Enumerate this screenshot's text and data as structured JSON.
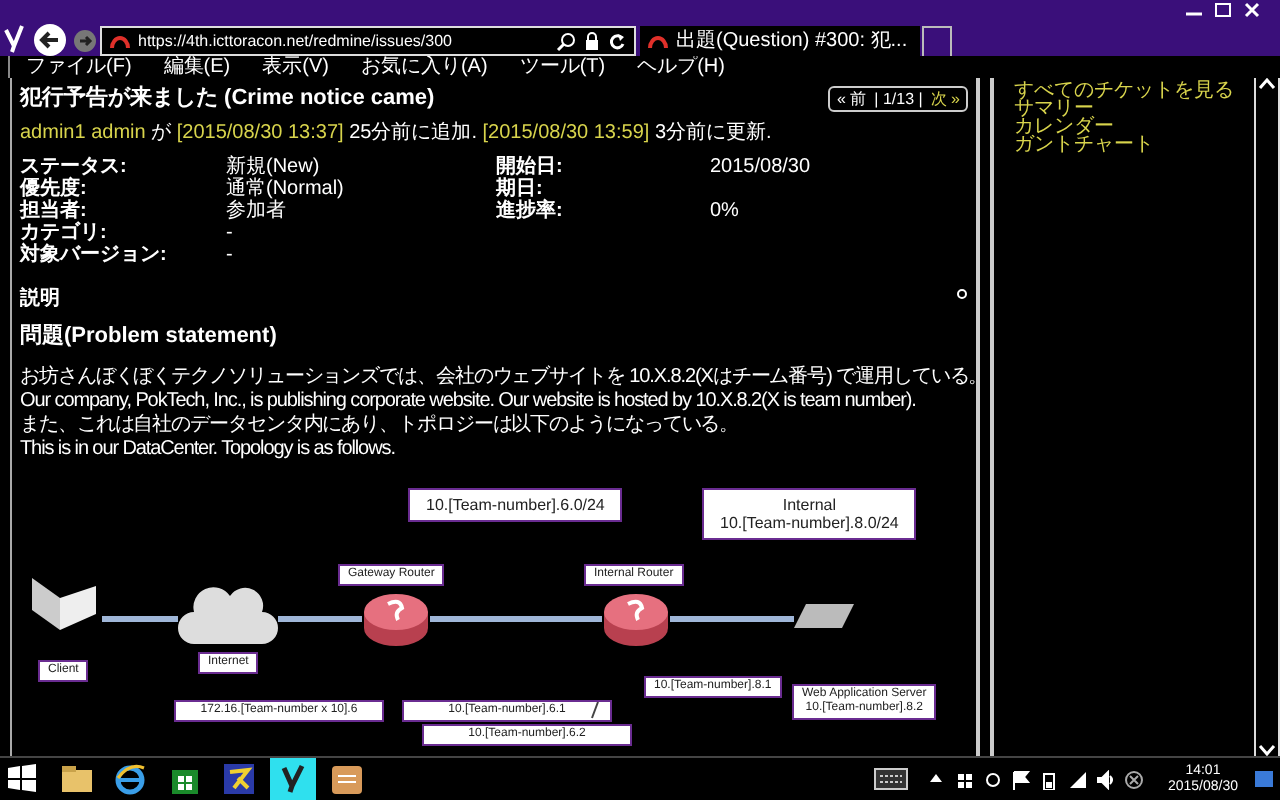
{
  "browser": {
    "address": "https://4th.icttoracon.net/redmine/issues/300",
    "tab_title": "出題(Question) #300: 犯..."
  },
  "menu": [
    "ファイル(F)",
    "編集(E)",
    "表示(V)",
    "お気に入り(A)",
    "ツール(T)",
    "ヘルプ(H)"
  ],
  "issue": {
    "title": "犯行予告が来ました (Crime notice came)",
    "pager": {
      "prev": "« 前",
      "position": "| 1/13 |",
      "next": "次 »"
    },
    "byline": [
      {
        "text": "admin1 admin",
        "link": true
      },
      {
        "text": " が ",
        "link": false
      },
      {
        "text": "[2015/08/30 13:37]",
        "link": true
      },
      {
        "text": " 25分前に追加. ",
        "link": false
      },
      {
        "text": "[2015/08/30 13:59]",
        "link": true
      },
      {
        "text": " 3分前に更新.",
        "link": false
      }
    ],
    "attributes": [
      {
        "label": "ステータス:",
        "value": "新規(New)",
        "label_2": "開始日:",
        "value_2": "2015/08/30"
      },
      {
        "label": "優先度:",
        "value": "通常(Normal)",
        "label_2": "期日:"
      },
      {
        "label": "担当者:",
        "value": "参加者",
        "label_2": "進捗率:",
        "value_2": "0%"
      },
      {
        "label": "カテゴリ:",
        "value": "-"
      },
      {
        "label": "対象バージョン:",
        "value": "-"
      }
    ],
    "description_label": "説明",
    "heading": "問題(Problem statement)",
    "paragraphs": [
      "お坊さんぼくぼくテクノソリューションズでは、会社のウェブサイトを 10.X.8.2(Xはチーム番号) で運用している。",
      "Our company, PokTech, Inc., is publishing corporate website. Our website is hosted by 10.X.8.2(X is team number).",
      "また、これは自社のデータセンタ内にあり、トポロジーは以下のようになっている。",
      "This is in our DataCenter. Topology is as follows."
    ],
    "diagram": {
      "nodes": [
        {
          "kind": "laptop"
        },
        {
          "kind": "cloud"
        },
        {
          "kind": "router"
        },
        {
          "kind": "router"
        },
        {
          "kind": "server"
        }
      ],
      "labels": [
        "10.[Team-number].6.0/24",
        "Internal\n10.[Team-number].8.0/24",
        "Gateway Router",
        "Internal Router",
        "Client",
        "Internet",
        "172.16.[Team-number x 10].6",
        "10.[Team-number].6.1",
        "10.[Team-number].8.1",
        "Web Application Server\n10.[Team-number].8.2",
        "10.[Team-number].6.2"
      ]
    }
  },
  "sidebar": [
    "すべてのチケットを見る",
    "サマリー",
    "カレンダー",
    "ガントチャート"
  ],
  "taskbar": {
    "apps": [
      {
        "kind": "start",
        "selected": false
      },
      {
        "kind": "folder",
        "selected": false
      },
      {
        "kind": "browser",
        "selected": false
      },
      {
        "kind": "store",
        "selected": false
      },
      {
        "kind": "app",
        "selected": false
      },
      {
        "kind": "bird",
        "selected": true
      },
      {
        "kind": "notes",
        "selected": false
      }
    ],
    "time": "14:01",
    "date": "2015/08/30"
  }
}
